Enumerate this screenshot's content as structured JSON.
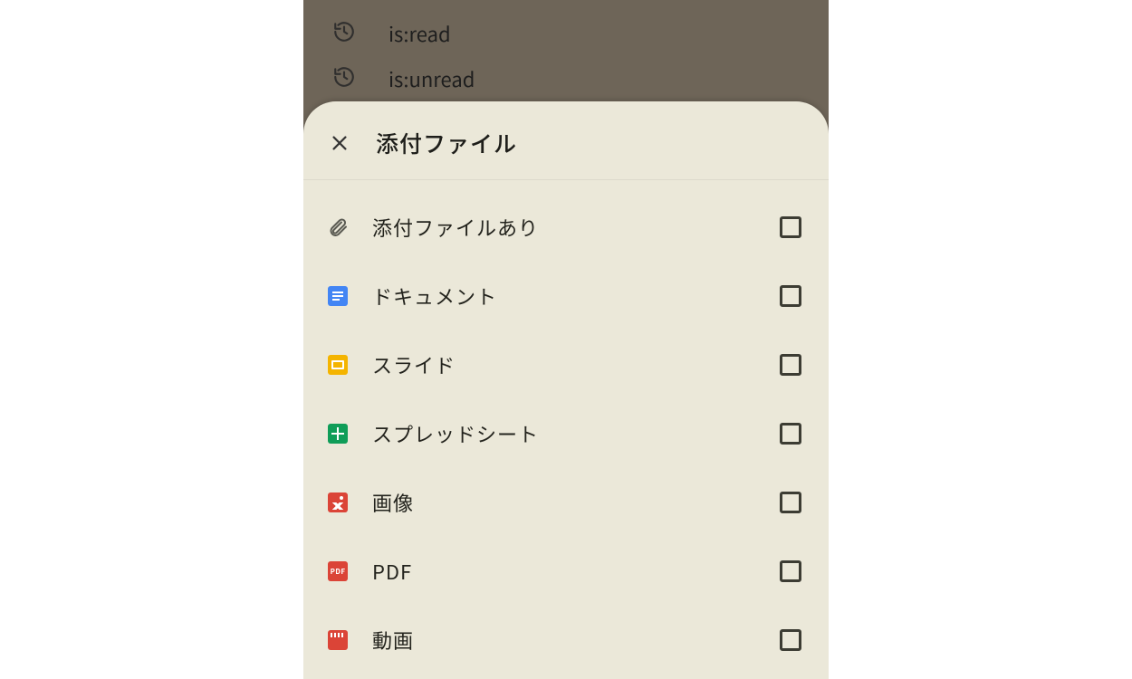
{
  "background": {
    "items": [
      {
        "label": "is:read"
      },
      {
        "label": "is:unread"
      }
    ]
  },
  "sheet": {
    "title": "添付ファイル",
    "options": [
      {
        "id": "has-attachment",
        "label": "添付ファイルあり",
        "icon": "attachment"
      },
      {
        "id": "document",
        "label": "ドキュメント",
        "icon": "docs"
      },
      {
        "id": "slide",
        "label": "スライド",
        "icon": "slides"
      },
      {
        "id": "spreadsheet",
        "label": "スプレッドシート",
        "icon": "sheets"
      },
      {
        "id": "image",
        "label": "画像",
        "icon": "image"
      },
      {
        "id": "pdf",
        "label": "PDF",
        "icon": "pdf"
      },
      {
        "id": "video",
        "label": "動画",
        "icon": "video"
      }
    ]
  },
  "icons": {
    "pdf_text": "PDF"
  }
}
